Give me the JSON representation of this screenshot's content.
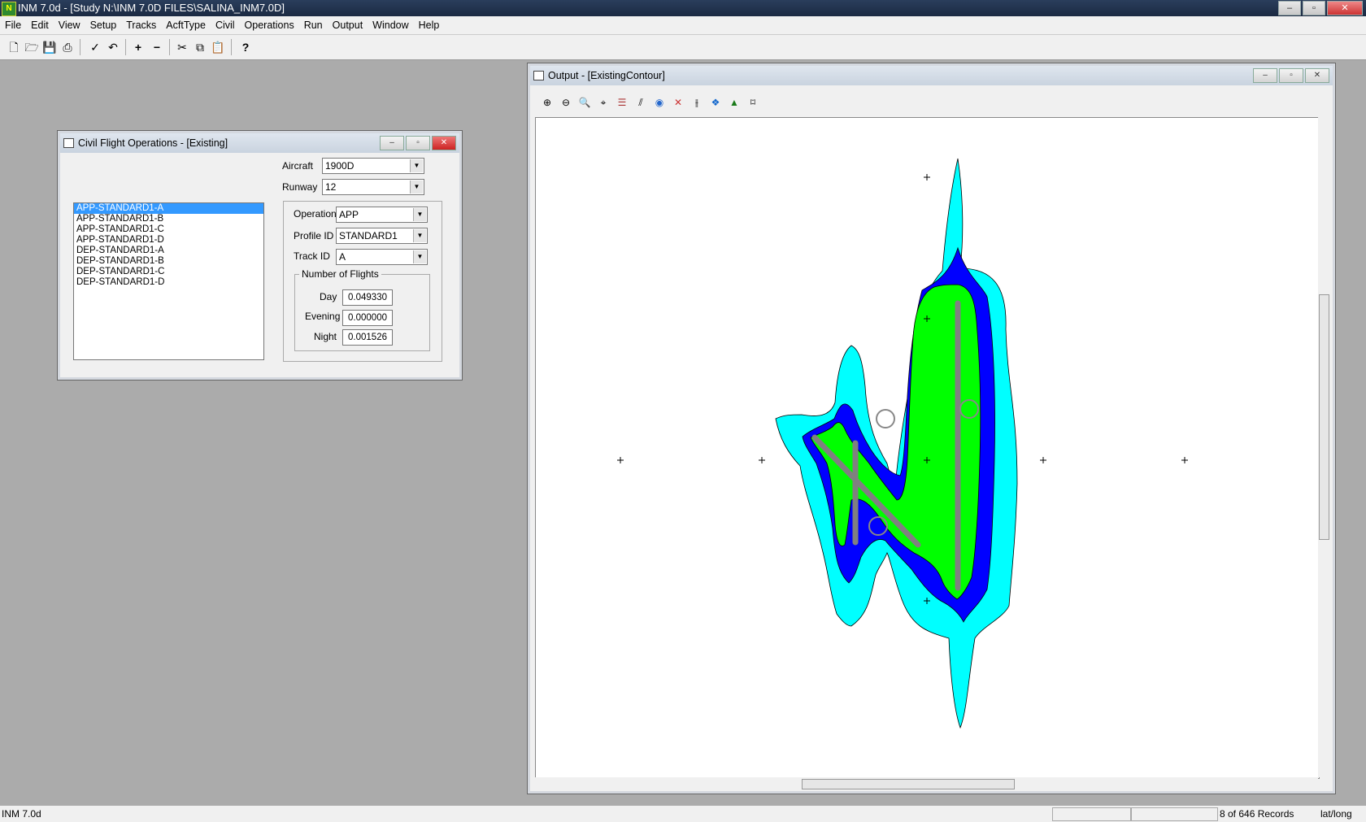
{
  "app": {
    "title": "INM 7.0d  - [Study N:\\INM 7.0D FILES\\SALINA_INM7.0D]",
    "icon_label": "N",
    "window_buttons": [
      "–",
      "▫",
      "✕"
    ]
  },
  "menu": [
    "File",
    "Edit",
    "View",
    "Setup",
    "Tracks",
    "AcftType",
    "Civil",
    "Operations",
    "Run",
    "Output",
    "Window",
    "Help"
  ],
  "toolbar_icons": [
    "new-icon",
    "open-icon",
    "save-icon",
    "print-icon",
    "check-icon",
    "undo-icon",
    "add-icon",
    "remove-icon",
    "cut-icon",
    "copy-icon",
    "paste-icon",
    "help-icon"
  ],
  "civil_window": {
    "title": "Civil Flight Operations - [Existing]",
    "aircraft_label": "Aircraft",
    "aircraft_value": "1900D",
    "runway_label": "Runway",
    "runway_value": "12",
    "list": [
      "APP-STANDARD1-A",
      "APP-STANDARD1-B",
      "APP-STANDARD1-C",
      "APP-STANDARD1-D",
      "DEP-STANDARD1-A",
      "DEP-STANDARD1-B",
      "DEP-STANDARD1-C",
      "DEP-STANDARD1-D"
    ],
    "selected_index": 0,
    "operation_label": "Operation",
    "operation_value": "APP",
    "profile_label": "Profile ID",
    "profile_value": "STANDARD1",
    "track_label": "Track ID",
    "track_value": "A",
    "flights_legend": "Number of Flights",
    "day_label": "Day",
    "day_value": "0.049330",
    "evening_label": "Evening",
    "evening_value": "0.000000",
    "night_label": "Night",
    "night_value": "0.001526"
  },
  "output_window": {
    "title": "Output - [ExistingContour]",
    "toolbar_icons": [
      "zoom-in-icon",
      "zoom-out-icon",
      "zoom-fit-icon",
      "center-icon",
      "layers-icon",
      "tracks-icon",
      "globe-icon",
      "grid-icon",
      "runway-icon",
      "points-icon",
      "contour-icon",
      "bounds-icon"
    ],
    "contour_colors": {
      "outer": "#00ffff",
      "middle": "#0000ff",
      "inner": "#00ff00",
      "runway": "#808080"
    }
  },
  "status": {
    "left": "INM 7.0d",
    "records": "8 of 646  Records",
    "coords": "lat/long"
  }
}
